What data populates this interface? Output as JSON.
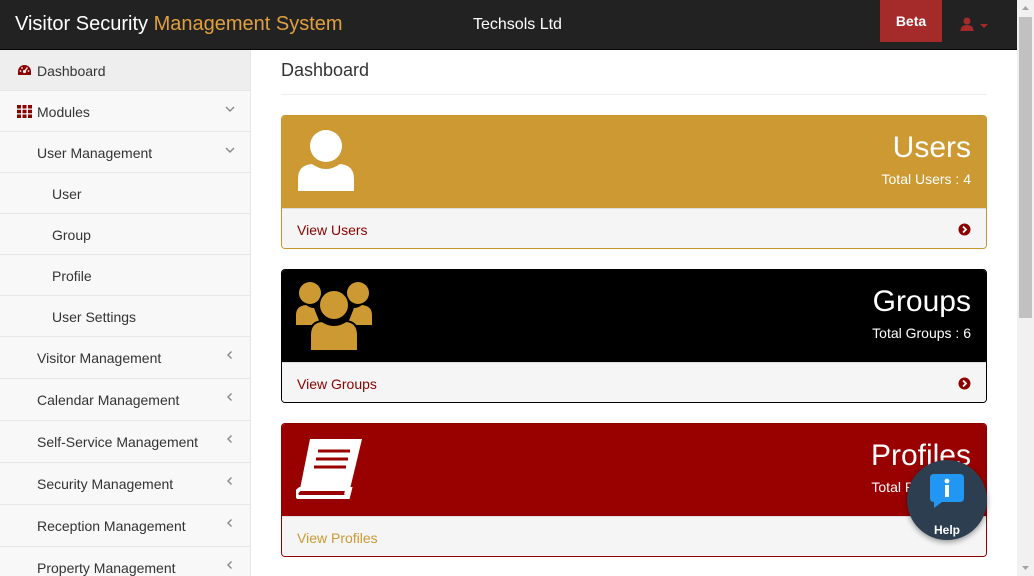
{
  "header": {
    "brand_main": "Visitor Security",
    "brand_accent": "Management System",
    "company": "Techsols Ltd",
    "beta_label": "Beta",
    "user_icon": "user-icon"
  },
  "sidebar": {
    "items": [
      {
        "label": "Dashboard",
        "icon": "dashboard-icon"
      },
      {
        "label": "Modules",
        "icon": "grid-icon"
      },
      {
        "label": "User Management"
      },
      {
        "label": "User"
      },
      {
        "label": "Group"
      },
      {
        "label": "Profile"
      },
      {
        "label": "User Settings"
      },
      {
        "label": "Visitor Management"
      },
      {
        "label": "Calendar Management"
      },
      {
        "label": "Self-Service Management"
      },
      {
        "label": "Security Management"
      },
      {
        "label": "Reception Management"
      },
      {
        "label": "Property Management"
      }
    ]
  },
  "main": {
    "page_title": "Dashboard",
    "panels": [
      {
        "title": "Users",
        "count": "Total Users : 4",
        "link": "View Users",
        "icon": "user-icon",
        "color": "#cc9933"
      },
      {
        "title": "Groups",
        "count": "Total Groups : 6",
        "link": "View Groups",
        "icon": "group-icon",
        "color": "#000000"
      },
      {
        "title": "Profiles",
        "count": "Total Profiles : 4",
        "link": "View Profiles",
        "icon": "book-icon",
        "color": "#990000"
      }
    ]
  },
  "help": {
    "label": "Help",
    "icon": "info-icon"
  },
  "colors": {
    "accent": "#e0a040",
    "navbar": "#222222",
    "beta": "#a52a2a"
  }
}
